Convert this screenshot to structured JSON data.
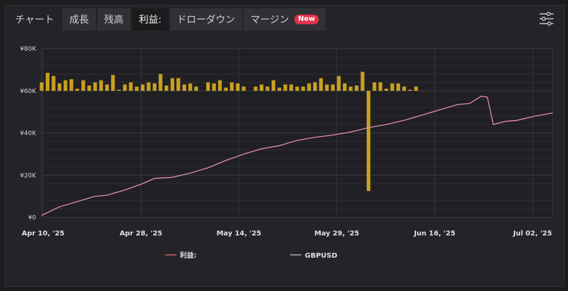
{
  "tabs": [
    {
      "label": "チャート",
      "active": false
    },
    {
      "label": "成長",
      "active": false
    },
    {
      "label": "残高",
      "active": false
    },
    {
      "label": "利益:",
      "active": true
    },
    {
      "label": "ドローダウン",
      "active": false
    },
    {
      "label": "マージン",
      "active": false,
      "badge": "New"
    }
  ],
  "settings_icon": "sliders-icon",
  "colors": {
    "line": "#e58fb0",
    "bar": "#c9a020",
    "grid": "#3a3a3f",
    "legend_profit": "#b04a5a",
    "legend_gbpusd": "#8a8a90"
  },
  "chart_data": {
    "type": "line+bar",
    "y_ticks": [
      "¥80K",
      "¥60K",
      "¥40K",
      "¥20K",
      "¥0"
    ],
    "y_range": [
      0,
      80000
    ],
    "x_labels": [
      "Apr 10, '25",
      "Apr 28, '25",
      "May 14, '25",
      "May 29, '25",
      "Jun 16, '25",
      "Jul 02, '25"
    ],
    "x_range": [
      "2025-04-10",
      "2025-07-05"
    ],
    "legend": [
      "利益:",
      "GBPUSD"
    ],
    "profit_series": [
      [
        "2025-04-10",
        1000
      ],
      [
        "2025-04-13",
        5000
      ],
      [
        "2025-04-16",
        7500
      ],
      [
        "2025-04-19",
        10000
      ],
      [
        "2025-04-21",
        10500
      ],
      [
        "2025-04-24",
        13000
      ],
      [
        "2025-04-27",
        16000
      ],
      [
        "2025-04-29",
        18500
      ],
      [
        "2025-05-02",
        19000
      ],
      [
        "2025-05-05",
        21000
      ],
      [
        "2025-05-08",
        23500
      ],
      [
        "2025-05-11",
        27000
      ],
      [
        "2025-05-14",
        30000
      ],
      [
        "2025-05-17",
        32500
      ],
      [
        "2025-05-20",
        34000
      ],
      [
        "2025-05-23",
        36500
      ],
      [
        "2025-05-26",
        38000
      ],
      [
        "2025-05-29",
        39000
      ],
      [
        "2025-06-01",
        40500
      ],
      [
        "2025-06-04",
        42500
      ],
      [
        "2025-06-07",
        44000
      ],
      [
        "2025-06-10",
        46000
      ],
      [
        "2025-06-13",
        48500
      ],
      [
        "2025-06-16",
        51000
      ],
      [
        "2025-06-19",
        53500
      ],
      [
        "2025-06-21",
        54000
      ],
      [
        "2025-06-23",
        57500
      ],
      [
        "2025-06-24",
        57000
      ],
      [
        "2025-06-25",
        44000
      ],
      [
        "2025-06-27",
        45500
      ],
      [
        "2025-06-29",
        46000
      ],
      [
        "2025-07-02",
        48000
      ],
      [
        "2025-07-05",
        49500
      ]
    ],
    "daily_bars": [
      [
        "2025-04-10",
        4000
      ],
      [
        "2025-04-11",
        8500
      ],
      [
        "2025-04-12",
        7000
      ],
      [
        "2025-04-13",
        3500
      ],
      [
        "2025-04-14",
        5000
      ],
      [
        "2025-04-15",
        5500
      ],
      [
        "2025-04-16",
        1000
      ],
      [
        "2025-04-17",
        5000
      ],
      [
        "2025-04-18",
        2500
      ],
      [
        "2025-04-19",
        4000
      ],
      [
        "2025-04-20",
        5000
      ],
      [
        "2025-04-21",
        3000
      ],
      [
        "2025-04-22",
        7500
      ],
      [
        "2025-04-23",
        500
      ],
      [
        "2025-04-24",
        3000
      ],
      [
        "2025-04-25",
        4000
      ],
      [
        "2025-04-26",
        2000
      ],
      [
        "2025-04-27",
        3000
      ],
      [
        "2025-04-28",
        4000
      ],
      [
        "2025-04-29",
        3500
      ],
      [
        "2025-04-30",
        8000
      ],
      [
        "2025-05-01",
        2500
      ],
      [
        "2025-05-02",
        6000
      ],
      [
        "2025-05-03",
        6000
      ],
      [
        "2025-05-04",
        3000
      ],
      [
        "2025-05-05",
        3500
      ],
      [
        "2025-05-06",
        2000
      ],
      [
        "2025-05-08",
        4000
      ],
      [
        "2025-05-09",
        3500
      ],
      [
        "2025-05-10",
        5000
      ],
      [
        "2025-05-11",
        1500
      ],
      [
        "2025-05-12",
        4000
      ],
      [
        "2025-05-13",
        3500
      ],
      [
        "2025-05-14",
        2000
      ],
      [
        "2025-05-16",
        2000
      ],
      [
        "2025-05-17",
        3000
      ],
      [
        "2025-05-18",
        2000
      ],
      [
        "2025-05-19",
        5000
      ],
      [
        "2025-05-20",
        1500
      ],
      [
        "2025-05-21",
        3000
      ],
      [
        "2025-05-22",
        3000
      ],
      [
        "2025-05-23",
        2000
      ],
      [
        "2025-05-24",
        2000
      ],
      [
        "2025-05-25",
        3500
      ],
      [
        "2025-05-26",
        4000
      ],
      [
        "2025-05-27",
        6000
      ],
      [
        "2025-05-28",
        3000
      ],
      [
        "2025-05-29",
        3000
      ],
      [
        "2025-05-30",
        7000
      ],
      [
        "2025-05-31",
        3500
      ],
      [
        "2025-06-01",
        2000
      ],
      [
        "2025-06-02",
        2500
      ],
      [
        "2025-06-03",
        9000
      ],
      [
        "2025-06-04",
        -47500
      ],
      [
        "2025-06-05",
        4000
      ],
      [
        "2025-06-06",
        4000
      ],
      [
        "2025-06-07",
        1000
      ],
      [
        "2025-06-08",
        3500
      ],
      [
        "2025-06-09",
        3500
      ],
      [
        "2025-06-10",
        2000
      ],
      [
        "2025-06-11",
        500
      ],
      [
        "2025-06-12",
        2000
      ]
    ]
  }
}
